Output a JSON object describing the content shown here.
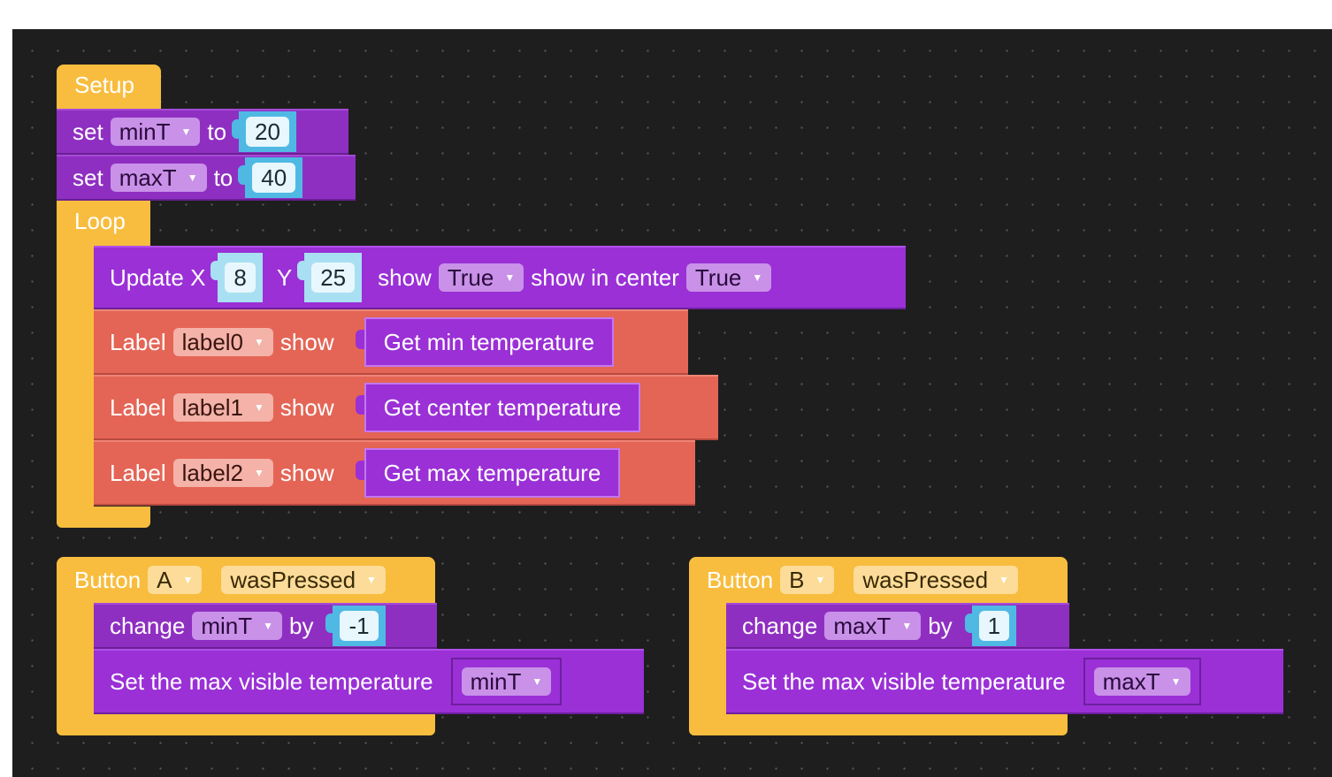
{
  "setup": {
    "hat_label": "Setup",
    "set_minT": {
      "keyword": "set",
      "variable": "minT",
      "to": "to",
      "value": "20"
    },
    "set_maxT": {
      "keyword": "set",
      "variable": "maxT",
      "to": "to",
      "value": "40"
    }
  },
  "loop": {
    "hat_label": "Loop",
    "update": {
      "label": "Update X",
      "x_value": "8",
      "y_label": "Y",
      "y_value": "25",
      "show_label": "show",
      "show_value": "True",
      "center_label": "show in center",
      "center_value": "True"
    },
    "labels": [
      {
        "keyword": "Label",
        "name": "label0",
        "show": "show",
        "reporter": "Get min temperature"
      },
      {
        "keyword": "Label",
        "name": "label1",
        "show": "show",
        "reporter": "Get center temperature"
      },
      {
        "keyword": "Label",
        "name": "label2",
        "show": "show",
        "reporter": "Get max temperature"
      }
    ]
  },
  "buttonA": {
    "label": "Button",
    "button": "A",
    "event": "wasPressed",
    "change": {
      "keyword": "change",
      "variable": "minT",
      "by": "by",
      "value": "-1"
    },
    "set_visible": {
      "label": "Set the max visible temperature",
      "variable": "minT"
    }
  },
  "buttonB": {
    "label": "Button",
    "button": "B",
    "event": "wasPressed",
    "change": {
      "keyword": "change",
      "variable": "maxT",
      "by": "by",
      "value": "1"
    },
    "set_visible": {
      "label": "Set the max visible temperature",
      "variable": "maxT"
    }
  },
  "icons": {
    "dropdown_caret": "▼"
  },
  "colors": {
    "workspace": "#1e1e1e",
    "event_hat": "#f8bd3e",
    "variable_block": "#8f2fc2",
    "display_block": "#9a30d6",
    "label_block": "#e46556",
    "number_block": "#4fb9e4"
  }
}
